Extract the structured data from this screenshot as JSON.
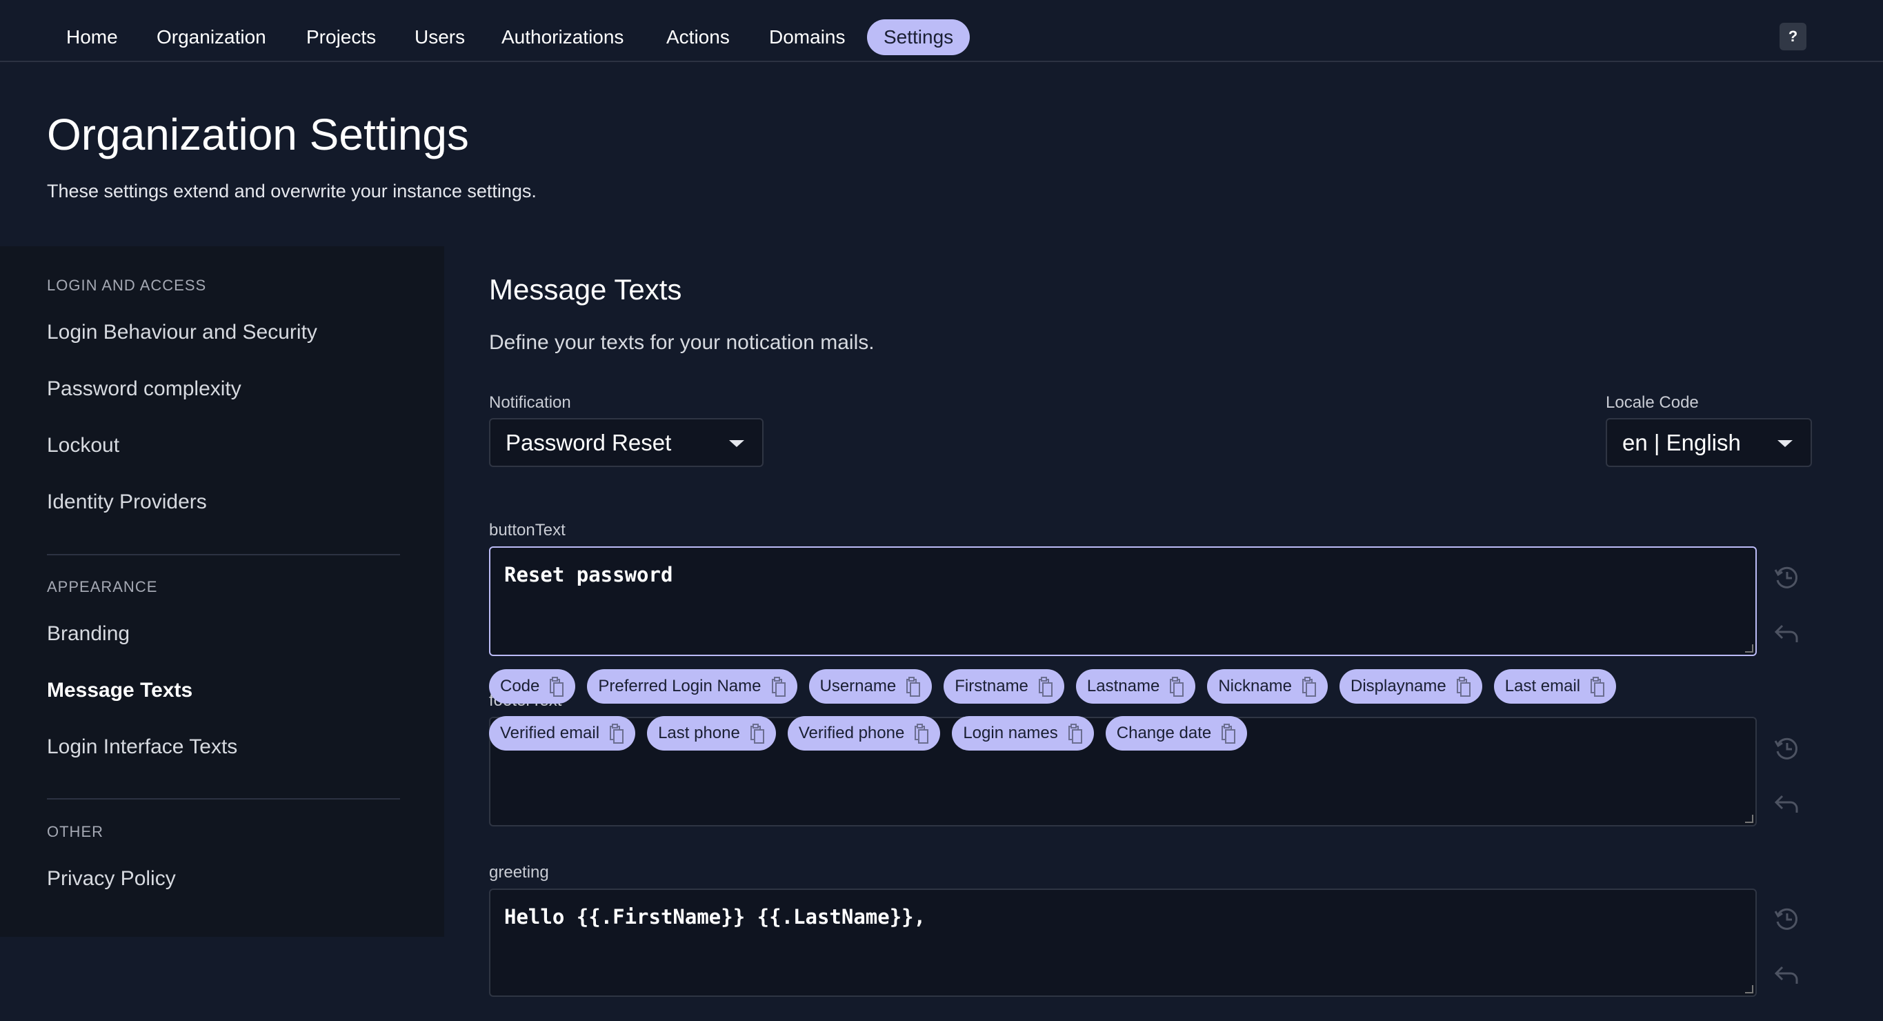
{
  "nav": {
    "items": [
      "Home",
      "Organization",
      "Projects",
      "Users",
      "Authorizations",
      "Actions",
      "Domains",
      "Settings"
    ],
    "active": "Settings",
    "help": "?"
  },
  "header": {
    "title": "Organization Settings",
    "subtitle": "These settings extend and overwrite your instance settings."
  },
  "sidebar": {
    "sections": [
      {
        "title": "LOGIN AND ACCESS",
        "items": [
          "Login Behaviour and Security",
          "Password complexity",
          "Lockout",
          "Identity Providers"
        ]
      },
      {
        "title": "APPEARANCE",
        "items": [
          "Branding",
          "Message Texts",
          "Login Interface Texts"
        ]
      },
      {
        "title": "OTHER",
        "items": [
          "Privacy Policy"
        ]
      }
    ],
    "active": "Message Texts"
  },
  "main": {
    "title": "Message Texts",
    "description": "Define your texts for your notication mails.",
    "notification": {
      "label": "Notification",
      "value": "Password Reset"
    },
    "locale": {
      "label": "Locale Code",
      "value": "en | English"
    },
    "fields": [
      {
        "label": "buttonText",
        "value": "Reset password"
      },
      {
        "label": "footerText",
        "value": ""
      },
      {
        "label": "greeting",
        "value": "Hello {{.FirstName}} {{.LastName}},"
      }
    ],
    "chips": [
      "Code",
      "Preferred Login Name",
      "Username",
      "Firstname",
      "Lastname",
      "Nickname",
      "Displayname",
      "Last email",
      "Verified email",
      "Last phone",
      "Verified phone",
      "Login names",
      "Change date"
    ]
  },
  "colors": {
    "background": "#131a2a",
    "accent": "#bcbcf7"
  }
}
